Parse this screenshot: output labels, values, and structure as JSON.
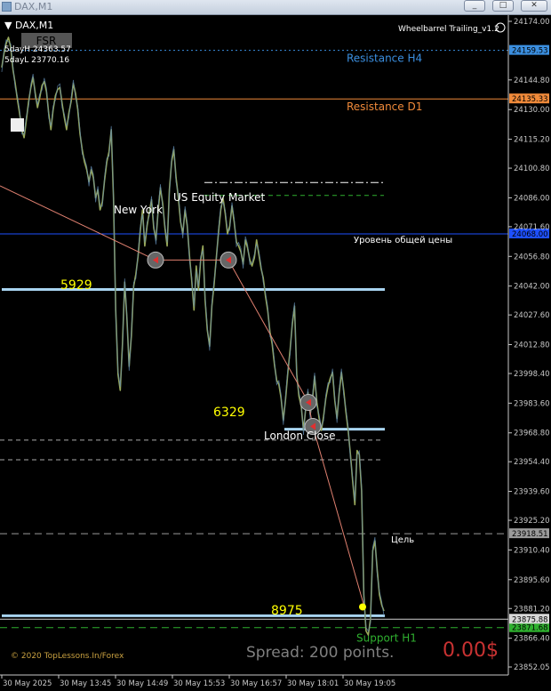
{
  "window": {
    "title": "DAX,M1",
    "buttons": {
      "minimize": "_",
      "restore": "□",
      "close": "✕"
    }
  },
  "chart_header": {
    "symbol": "DAX,M1",
    "indicator_name": "Wheelbarrel Trailing_v1.2",
    "fsr_label": "FSR",
    "five_day_high": "5dayH 24363.57",
    "five_day_low": "5dayL 23770.16",
    "copyright": "© 2020 TopLessons.In/Forex",
    "spread_text": "Spread: 200 points.",
    "profit_text": "0.00$"
  },
  "chart_data": {
    "type": "line",
    "title": "DAX,M1",
    "ylim": [
      23852.05,
      24174.0
    ],
    "y_ticks": [
      "24174.00",
      "24159.53",
      "24144.80",
      "24130.00",
      "24115.20",
      "24100.80",
      "24086.00",
      "24071.60",
      "24056.80",
      "24042.00",
      "24027.60",
      "24012.80",
      "23998.40",
      "23983.60",
      "23968.80",
      "23954.40",
      "23939.60",
      "23925.20",
      "23918.51",
      "23910.40",
      "23895.60",
      "23881.20",
      "23875.88",
      "23871.68",
      "23866.40",
      "23852.05"
    ],
    "x_ticks": [
      "30 May 2025",
      "30 May 13:45",
      "30 May 14:49",
      "30 May 15:53",
      "30 May 16:57",
      "30 May 18:01",
      "30 May 19:05"
    ],
    "levels": [
      {
        "label": "Resistance H4",
        "value": 24159.53,
        "color": "#3b8fe0",
        "style": "dotted",
        "tag": "24159.53"
      },
      {
        "label": "Resistance D1",
        "value": 24135.33,
        "color": "#f08a3a",
        "style": "solid",
        "tag": "24135.33"
      },
      {
        "label": "Уровень общей цены",
        "value": 24068.0,
        "color": "#1e50ff",
        "style": "solid",
        "tag": "24068.00"
      },
      {
        "label": "Цель",
        "value": 23918.51,
        "color": "#9a9a9a",
        "style": "dashed",
        "tag": "23918.51"
      },
      {
        "label": "Support H1",
        "value": 23871.68,
        "color": "#2fb02f",
        "style": "dashed",
        "tag": "23871.68"
      },
      {
        "label": "",
        "value": 23875.88,
        "color": "#d0d0d0",
        "style": "solid",
        "tag": "23875.88"
      }
    ],
    "session_labels": [
      "New York",
      "US Equity Market",
      "London Close"
    ],
    "zone_numbers": [
      "5929",
      "6329",
      "8975"
    ],
    "price_series": [
      24151,
      24158,
      24163,
      24166,
      24161,
      24150,
      24143,
      24135,
      24128,
      24120,
      24116,
      24125,
      24134,
      24141,
      24146,
      24138,
      24131,
      24136,
      24142,
      24144,
      24139,
      24128,
      24120,
      24130,
      24137,
      24140,
      24141,
      24133,
      24126,
      24120,
      24128,
      24134,
      24143,
      24138,
      24130,
      24118,
      24110,
      24104,
      24100,
      24094,
      24100,
      24096,
      24086,
      24090,
      24080,
      24084,
      24095,
      24104,
      24109,
      24120,
      24086,
      24030,
      23998,
      23990,
      24013,
      24044,
      24026,
      24002,
      24017,
      24042,
      24048,
      24057,
      24070,
      24080,
      24062,
      24072,
      24079,
      24085,
      24071,
      24065,
      24080,
      24091,
      24083,
      24071,
      24062,
      24090,
      24104,
      24110,
      24096,
      24086,
      24074,
      24068,
      24080,
      24072,
      24057,
      24045,
      24030,
      24052,
      24040,
      24055,
      24062,
      24035,
      24020,
      24012,
      24032,
      24043,
      24056,
      24069,
      24080,
      24086,
      24078,
      24068,
      24072,
      24082,
      24074,
      24064,
      24062,
      24059,
      24053,
      24065,
      24061,
      24055,
      24052,
      24056,
      24065,
      24058,
      24051,
      24046,
      24037,
      24030,
      24019,
      24013,
      24003,
      23995,
      23993,
      23986,
      23975,
      23986,
      23999,
      24010,
      24023,
      24032,
      23998,
      23987,
      23982,
      23970,
      23981,
      23989,
      23978,
      23985,
      23997,
      23984,
      23976,
      23970,
      23977,
      23986,
      23992,
      23996,
      23999,
      23985,
      23976,
      23989,
      23999,
      23990,
      23979,
      23970,
      23958,
      23945,
      23933,
      23960,
      23958,
      23940,
      23888,
      23870,
      23868,
      23876,
      23910,
      23915,
      23900,
      23888,
      23883,
      23880
    ],
    "trend_line": [
      [
        24092.0,
        0
      ],
      [
        24055.0,
        175
      ],
      [
        24055.0,
        257
      ],
      [
        23984.0,
        347
      ],
      [
        23972.0,
        352
      ],
      [
        23882.0,
        410
      ]
    ],
    "markers": [
      {
        "label": "sell",
        "at": [
          24055.0,
          175
        ]
      },
      {
        "label": "sell",
        "at": [
          24055.0,
          257
        ]
      },
      {
        "label": "sell",
        "at": [
          23984.0,
          347
        ]
      },
      {
        "label": "sell",
        "at": [
          23972.0,
          352
        ]
      }
    ]
  },
  "colors": {
    "background": "#000000",
    "price": "#98a85a",
    "axis": "#c8c8c8",
    "zone_line": "#a8d4f0",
    "zone_number": "#ffff00",
    "trend": "#e08070",
    "profit": "#c83232",
    "spread": "#808080",
    "copyright": "#c8a040"
  }
}
